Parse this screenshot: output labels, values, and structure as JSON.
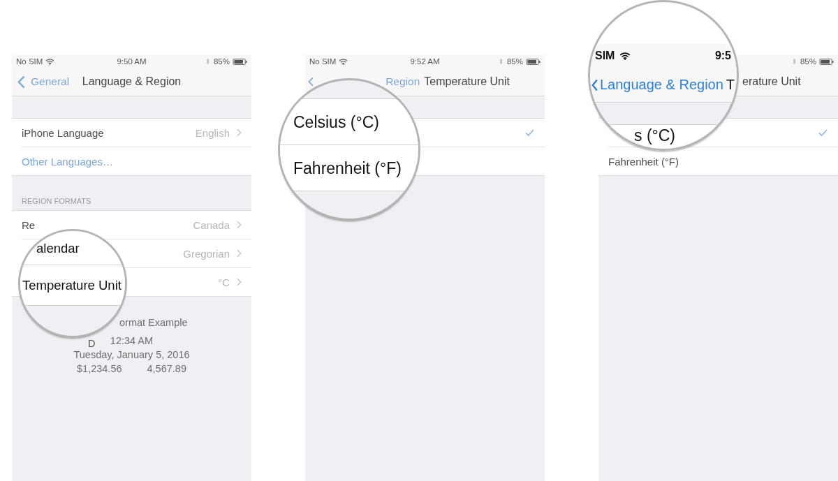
{
  "panels": [
    {
      "status_bar": {
        "carrier": "No SIM",
        "time": "9:50 AM",
        "battery": "85%"
      },
      "nav": {
        "back": "General",
        "title": "Language & Region"
      },
      "groups": [
        {
          "rows": [
            {
              "kind": "disclosure",
              "label": "iPhone Language",
              "value": "English"
            },
            {
              "kind": "link",
              "label": "Other Languages…"
            }
          ]
        },
        {
          "header": "REGION FORMATS",
          "rows": [
            {
              "kind": "disclosure",
              "label": "Re",
              "value": "Canada"
            },
            {
              "kind": "disclosure",
              "value": "Gregorian"
            },
            {
              "kind": "disclosure",
              "value": "°C"
            }
          ]
        }
      ],
      "example": {
        "covered_line": "D",
        "title": "ormat Example",
        "lines": [
          "12:34 AM",
          "Tuesday, January 5, 2016"
        ],
        "amounts": [
          "$1,234.56",
          "4,567.89"
        ]
      },
      "magnifier": {
        "kind": "rows",
        "rows": [
          "alendar",
          "Temperature Unit"
        ]
      }
    },
    {
      "status_bar": {
        "carrier": "No SIM",
        "time": "9:52 AM",
        "battery": "85%"
      },
      "nav": {
        "back": "Region",
        "title": "Temperature Unit"
      },
      "groups": [
        {
          "rows": [
            {
              "kind": "option",
              "selected": true
            },
            {
              "kind": "option",
              "selected": false
            }
          ]
        }
      ],
      "magnifier": {
        "kind": "rows",
        "rows": [
          "Celsius (°C)",
          "Fahrenheit (°F)"
        ]
      }
    },
    {
      "status_bar": {
        "battery": "85%"
      },
      "nav": {
        "title": "erature Unit"
      },
      "groups": [
        {
          "rows": [
            {
              "kind": "option",
              "selected": true
            },
            {
              "kind": "option",
              "label": "Fahrenheit (°F)",
              "selected": false
            }
          ]
        }
      ],
      "magnifier": {
        "kind": "header",
        "status_bar": {
          "carrier": "SIM",
          "time": "9:5"
        },
        "nav": {
          "back": "Language & Region",
          "title": "T"
        },
        "rows": [
          "s (°C)"
        ]
      }
    }
  ]
}
